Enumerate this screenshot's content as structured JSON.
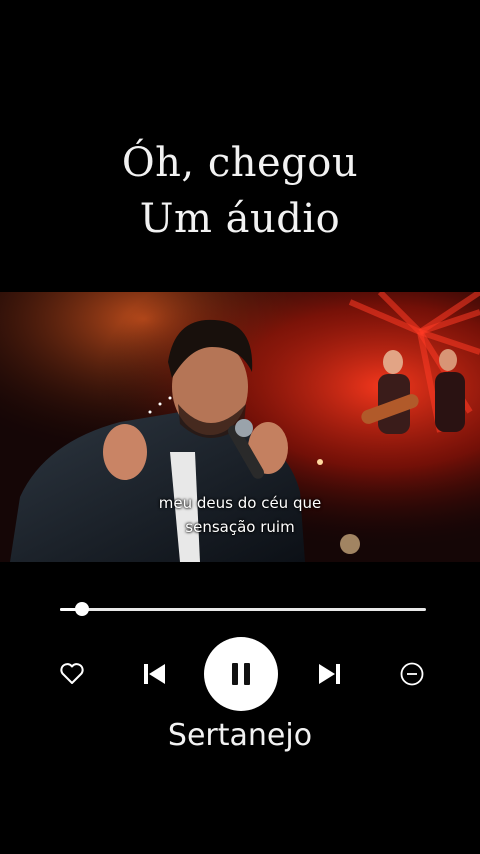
{
  "title": {
    "line1": "Óh, chegou",
    "line2": "Um áudio"
  },
  "video": {
    "subtitle_line1": "meu deus do céu que",
    "subtitle_line2": "sensação ruim"
  },
  "player": {
    "progress_fraction": 0.06,
    "icons": {
      "like": "heart-icon",
      "previous": "skip-previous-icon",
      "play_pause": "pause-icon",
      "next": "skip-next-icon",
      "remove": "minus-circle-icon"
    },
    "genre_label": "Sertanejo"
  },
  "colors": {
    "background": "#000000",
    "foreground": "#ffffff"
  }
}
